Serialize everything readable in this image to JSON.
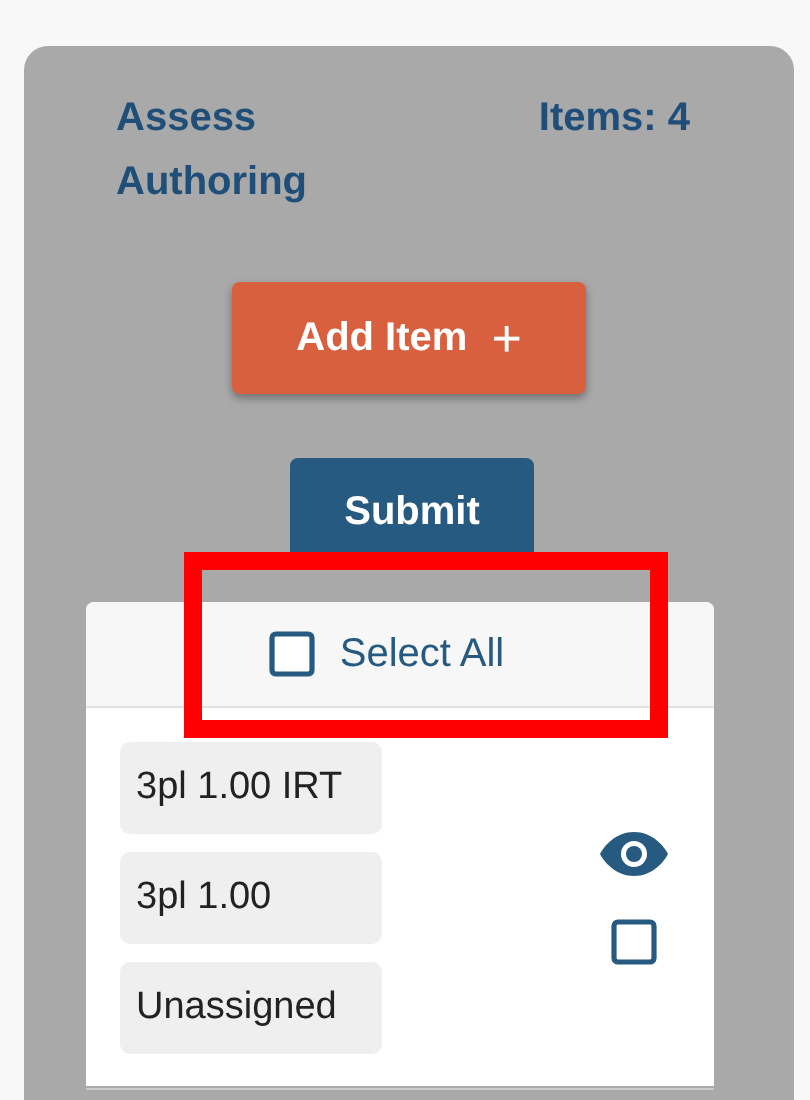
{
  "header": {
    "title": "Assess Authoring",
    "count": "Items: 4"
  },
  "buttons": [
    {
      "kind": "add",
      "label": "Add Item",
      "icon": "+"
    },
    {
      "kind": "submit",
      "label": "Submit"
    }
  ],
  "select_all": {
    "label": "Select All",
    "checked": false,
    "highlighted": true
  },
  "item": {
    "tags": [
      "3pl 1.00 IRT",
      "3pl 1.00",
      "Unassigned"
    ],
    "checked": false
  }
}
